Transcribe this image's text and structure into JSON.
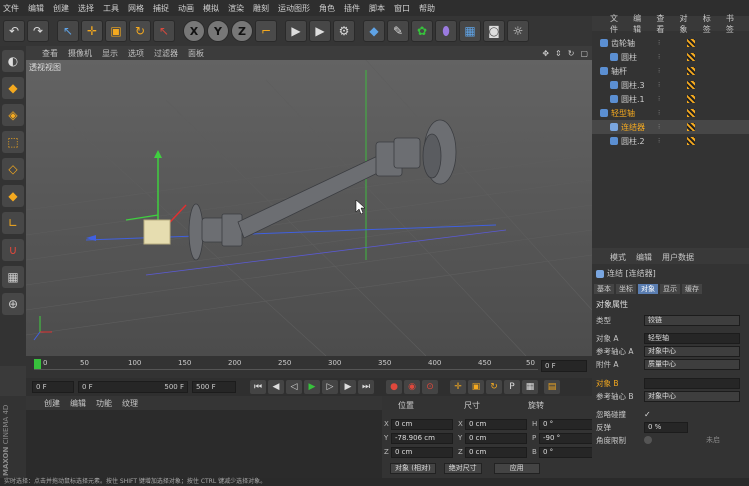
{
  "menubar": {
    "items": [
      "文件",
      "编辑",
      "创建",
      "选择",
      "工具",
      "网格",
      "捕捉",
      "动画",
      "模拟",
      "渲染",
      "雕刻",
      "运动图形",
      "角色",
      "插件",
      "脚本",
      "窗口",
      "帮助"
    ]
  },
  "toolbar": {
    "icons": [
      "undo-icon",
      "redo-icon",
      "select-icon",
      "move-icon",
      "scale-icon",
      "rotate-icon",
      "live-select-icon",
      "x-axis-icon",
      "y-axis-icon",
      "z-axis-icon",
      "coord-system-icon",
      "render-view-icon",
      "render-picture-icon",
      "render-settings-icon",
      "cube-icon",
      "pen-icon",
      "subdivision-icon",
      "deformer-icon",
      "floor-icon",
      "camera-icon",
      "light-icon"
    ],
    "axis_labels": [
      "X",
      "Y",
      "Z"
    ]
  },
  "viewport": {
    "menu": [
      "查看",
      "摄像机",
      "显示",
      "选项",
      "过滤器",
      "面板"
    ],
    "title": "透视视图"
  },
  "timeline": {
    "ticks": [
      "0",
      "50",
      "100",
      "150",
      "200",
      "250",
      "300",
      "350",
      "400",
      "450",
      "50"
    ],
    "frame_end_box": "0 F"
  },
  "framebar": {
    "start": "0 F",
    "current": "0 F",
    "end1": "500 F",
    "end2": "500 F"
  },
  "materials": {
    "menu": [
      "创建",
      "编辑",
      "功能",
      "纹理"
    ]
  },
  "logo": {
    "line1": "MAXON",
    "line2": "CINEMA 4D"
  },
  "coords": {
    "headers": [
      "位置",
      "尺寸",
      "旋转"
    ],
    "rows": [
      {
        "pl": "X",
        "pos": "0 cm",
        "sl": "X",
        "size": "0 cm",
        "rl": "H",
        "rot": "0 °"
      },
      {
        "pl": "Y",
        "pos": "-78.906 cm",
        "sl": "Y",
        "size": "0 cm",
        "rl": "P",
        "rot": "-90 °"
      },
      {
        "pl": "Z",
        "pos": "0 cm",
        "sl": "Z",
        "size": "0 cm",
        "rl": "B",
        "rot": "0 °"
      }
    ],
    "mode": "对象 (相对)",
    "size_mode": "绝对尺寸",
    "apply": "应用"
  },
  "objects": {
    "menu": [
      "文件",
      "编辑",
      "查看",
      "对象",
      "标签",
      "书签"
    ],
    "rows": [
      {
        "name": "齿轮轴",
        "indent": 0,
        "selected": false
      },
      {
        "name": "圆柱",
        "indent": 1,
        "selected": false
      },
      {
        "name": "轴杆",
        "indent": 0,
        "selected": false
      },
      {
        "name": "圆柱.3",
        "indent": 1,
        "selected": false
      },
      {
        "name": "圆柱.1",
        "indent": 1,
        "selected": false
      },
      {
        "name": "轻型轴",
        "indent": 0,
        "selected": false
      },
      {
        "name": "连结器",
        "indent": 1,
        "selected": true
      },
      {
        "name": "圆柱.2",
        "indent": 1,
        "selected": false
      }
    ]
  },
  "attributes": {
    "menu": [
      "模式",
      "编辑",
      "用户数据"
    ],
    "object_title": "连结 [连结器]",
    "tabs": [
      "基本",
      "坐标",
      "对象",
      "显示",
      "缓存"
    ],
    "active_tab": "对象",
    "section": "对象属性",
    "rows": [
      {
        "label": "类型",
        "value": "铰链"
      },
      {
        "label": "对象 A",
        "value": "轻型轴"
      },
      {
        "label": "参考轴心 A",
        "value": "对象中心"
      },
      {
        "label": "附件 A",
        "value": "质量中心"
      },
      {
        "label": "对象 B",
        "value": ""
      },
      {
        "label": "参考轴心 B",
        "value": "对象中心"
      },
      {
        "label": "忽略碰撞",
        "value": "✓"
      },
      {
        "label": "反弹",
        "value": "0 %"
      },
      {
        "label": "角度限制",
        "value": ""
      }
    ],
    "extra": "未启"
  },
  "status": {
    "text": "实时选择：点击并拖动鼠标选择元素。按住 SHIFT 键增加选择对象；按住 CTRL 键减少选择对象。"
  }
}
